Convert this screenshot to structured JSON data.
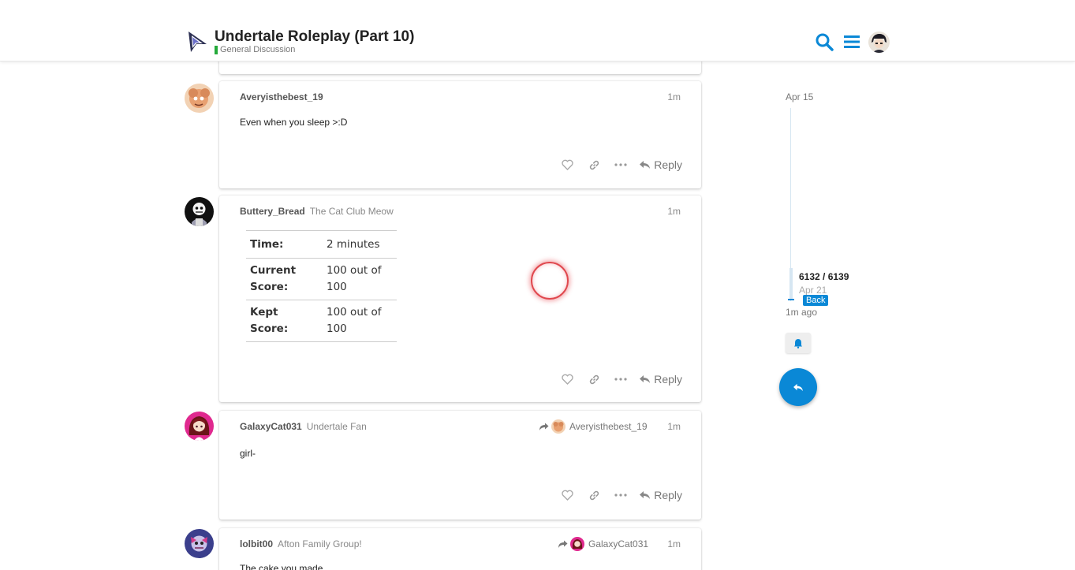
{
  "topic": {
    "title": "Undertale Roleplay (Part 10)",
    "category": "General Discussion",
    "category_color": "#25aa3a"
  },
  "header": {
    "icons": [
      "zoom-icon",
      "kebab-menu-icon",
      "minimize-icon",
      "restore-icon",
      "close-icon",
      "search-icon",
      "hamburger-icon"
    ],
    "accent_color": "#0a88d6"
  },
  "posts": [
    {
      "username": "Averyisthebest_19",
      "user_title": "",
      "time": "1m",
      "text": "Even when you sleep >:D",
      "reply_label": "Reply"
    },
    {
      "username": "Buttery_Bread",
      "user_title": "The Cat Club Meow",
      "time": "1m",
      "quiz": [
        {
          "key": "Time:",
          "value": "2 minutes"
        },
        {
          "key": "Current Score:",
          "value": "100 out of 100"
        },
        {
          "key": "Kept Score:",
          "value": "100 out of 100"
        }
      ],
      "reply_label": "Reply"
    },
    {
      "username": "GalaxyCat031",
      "user_title": "Undertale Fan",
      "time": "1m",
      "reply_to": "Averyisthebest_19",
      "text": "girl-",
      "reply_label": "Reply"
    },
    {
      "username": "lolbit00",
      "user_title": "Afton Family Group!",
      "time": "1m",
      "reply_to": "GalaxyCat031",
      "text": "The cake you made"
    }
  ],
  "timeline": {
    "start_date": "Apr 15",
    "position": "6132 / 6139",
    "position_date": "Apr 21",
    "back_label": "Back",
    "last_activity": "1m ago"
  }
}
